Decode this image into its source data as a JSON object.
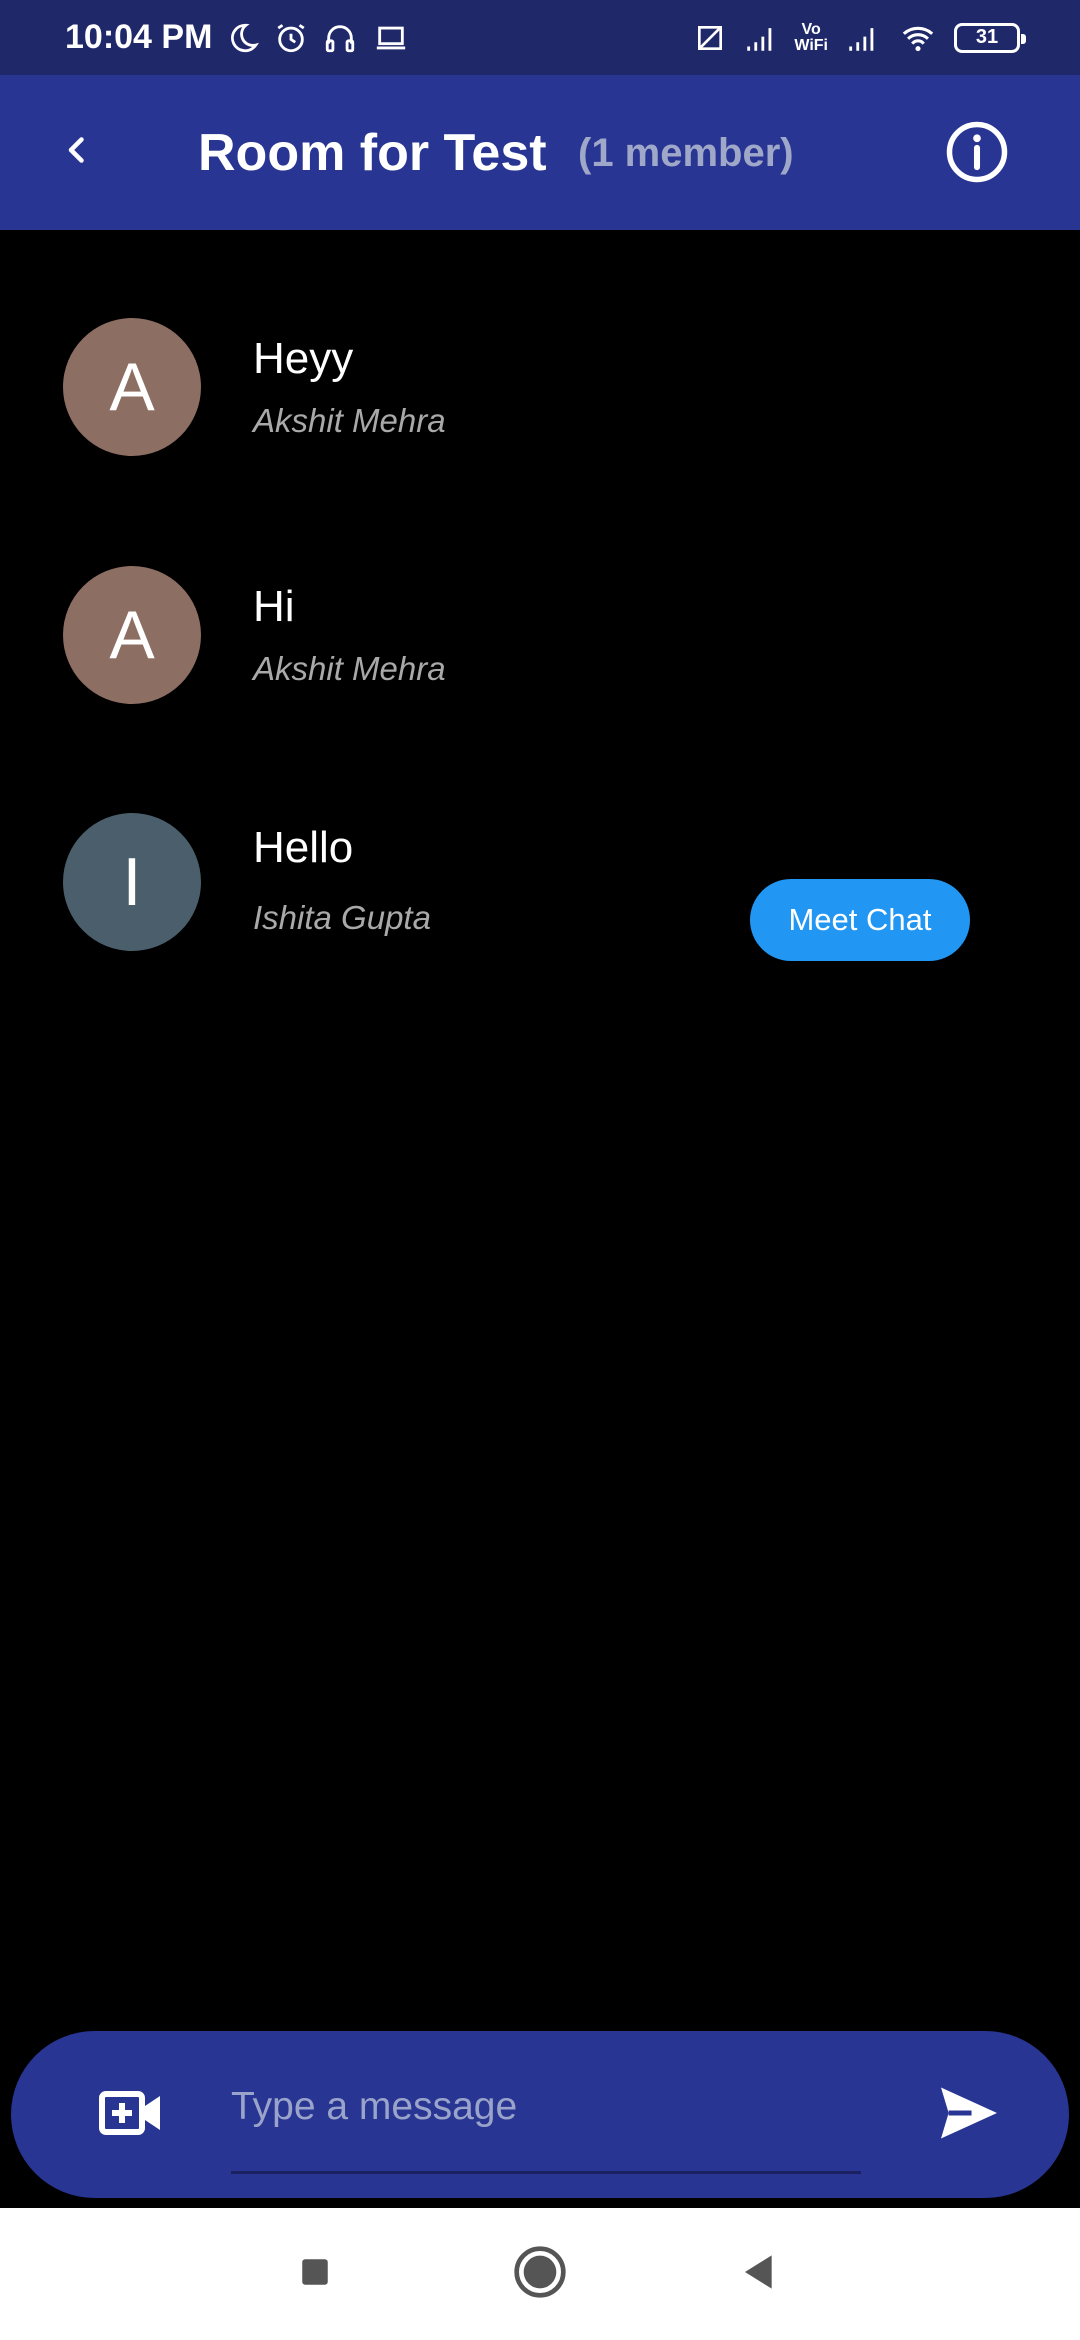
{
  "status_bar": {
    "time": "10:04 PM",
    "left_icons": [
      "moon-icon",
      "alarm-icon",
      "headset-icon",
      "laptop-icon"
    ],
    "right_icons": [
      "no-sim-icon",
      "signal-icon",
      "vowifi-icon",
      "signal-icon",
      "wifi-icon",
      "battery-icon"
    ],
    "vowifi_label": "Vo\nWiFi",
    "battery_level": "31"
  },
  "app_bar": {
    "title": "Room for Test",
    "member_count": "(1 member)",
    "back_icon": "chevron-left-icon",
    "info_icon": "info-icon"
  },
  "messages": [
    {
      "avatar_letter": "A",
      "avatar_color": "#8d6e63",
      "text": "Heyy",
      "sender": "Akshit Mehra"
    },
    {
      "avatar_letter": "A",
      "avatar_color": "#8d6e63",
      "text": "Hi",
      "sender": "Akshit Mehra"
    },
    {
      "avatar_letter": "I",
      "avatar_color": "#4a5f6b",
      "text": "Hello",
      "sender": "Ishita Gupta",
      "action_label": "Meet Chat"
    }
  ],
  "composer": {
    "placeholder": "Type a message",
    "video_icon": "video-add-icon",
    "send_icon": "send-icon"
  },
  "nav_bar": {
    "icons": [
      "recents-icon",
      "home-icon",
      "back-icon"
    ]
  },
  "colors": {
    "status_bar": "#1f2869",
    "app_bar": "#283593",
    "accent": "#2196f3",
    "background": "#000000"
  }
}
